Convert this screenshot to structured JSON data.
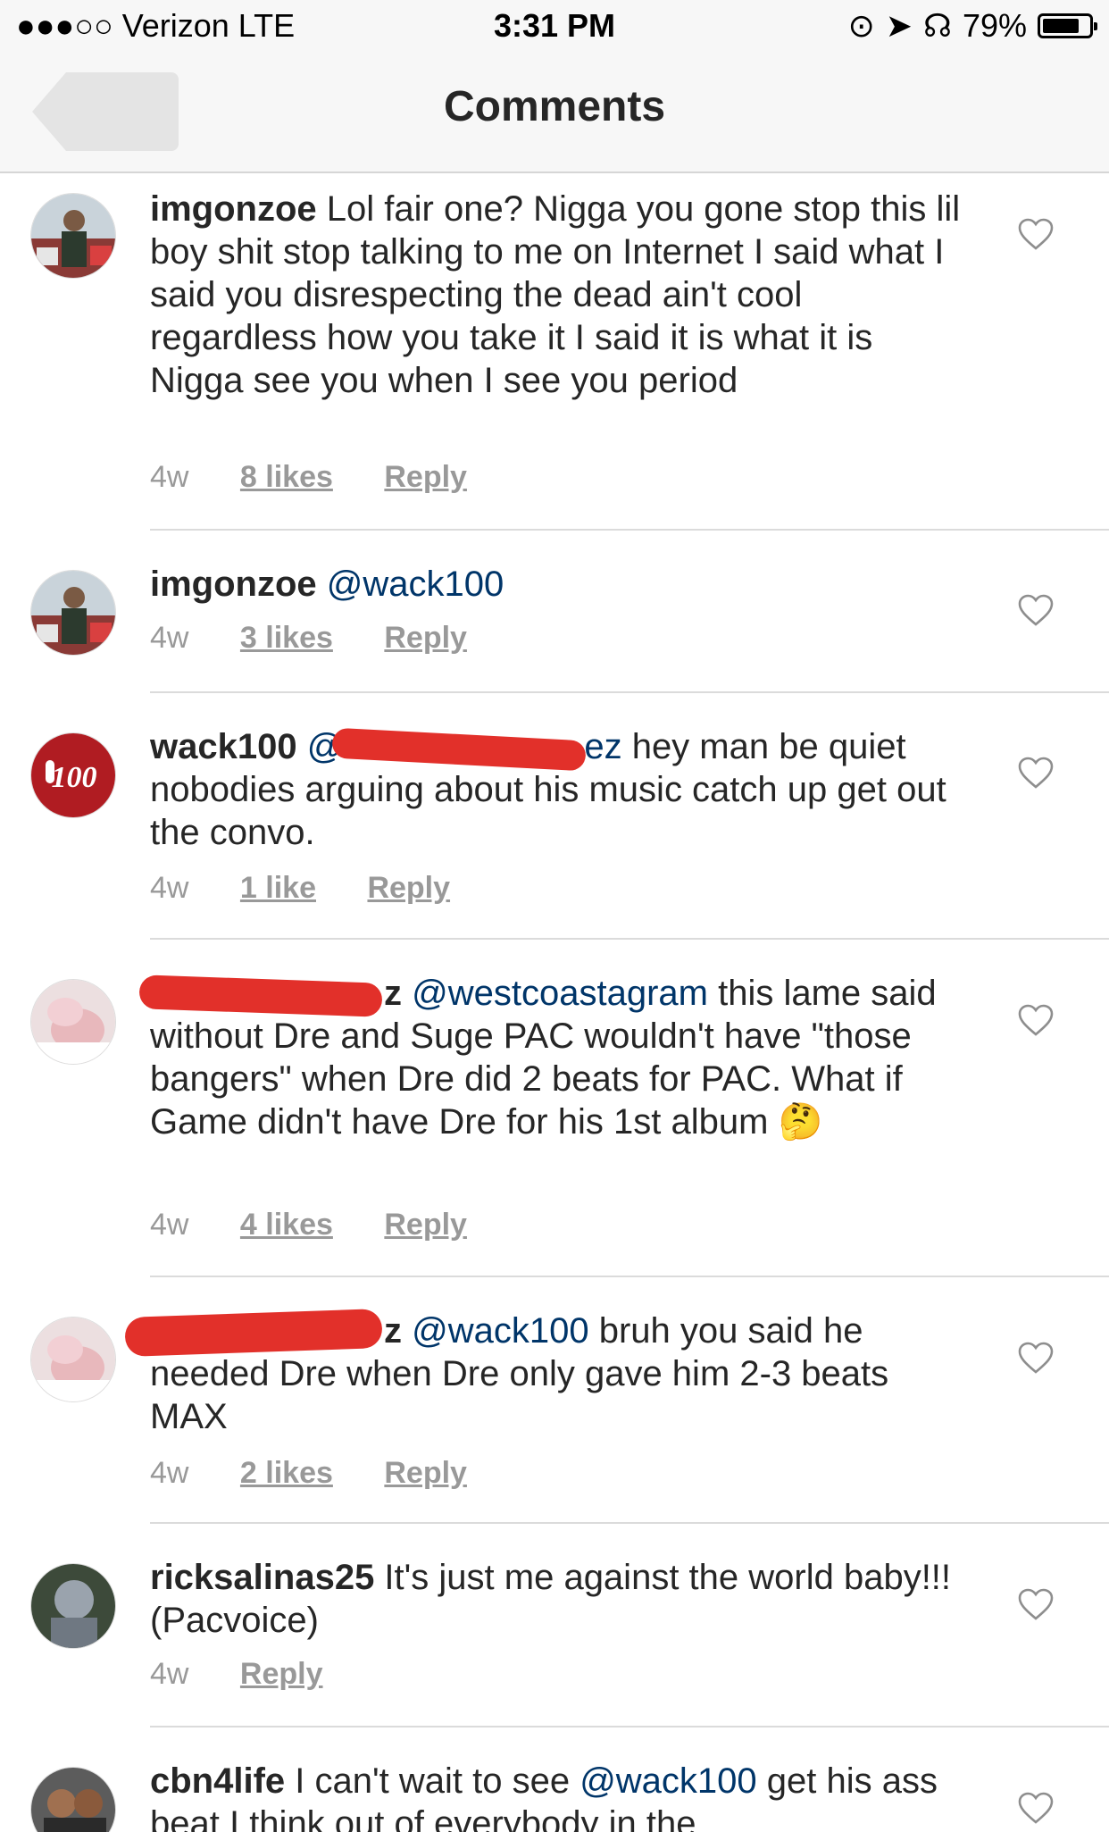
{
  "status_bar": {
    "carrier": "●●●○○ Verizon  LTE",
    "time": "3:31 PM",
    "battery": "79%",
    "battery_level": 0.79
  },
  "nav": {
    "title": "Comments"
  },
  "comments": [
    {
      "user": "imgonzoe",
      "text": "Lol fair one? Nigga you gone stop this lil boy shit stop talking to me on Internet I said what I said you disrespecting the dead ain't cool regardless how you take it I said it is what it is Nigga see you when I see you period",
      "age": "4w",
      "likes": "8 likes",
      "reply": "Reply"
    },
    {
      "user": "imgonzoe",
      "mention": "@wack100",
      "age": "4w",
      "likes": "3 likes",
      "reply": "Reply"
    },
    {
      "user": "wack100",
      "mention_partial": "@",
      "mention_tail": "ez",
      "text": " hey man be quiet nobodies arguing about his music catch up get out the convo.",
      "age": "4w",
      "likes": "1 like",
      "reply": "Reply"
    },
    {
      "user_tail": "z",
      "mention": "@westcoastagram",
      "text": "  this lame said without Dre and Suge PAC wouldn't have \"those bangers\" when Dre did 2 beats for PAC. What if Game didn't have Dre for his 1st album 🤔",
      "age": "4w",
      "likes": "4 likes",
      "reply": "Reply"
    },
    {
      "user_tail": "z",
      "mention": "@wack100",
      "text": "  bruh you said he needed Dre when Dre only gave him 2-3 beats MAX",
      "age": "4w",
      "likes": "2 likes",
      "reply": "Reply"
    },
    {
      "user": "ricksalinas25",
      "text": " It's just me against the world baby!!! (Pacvoice)",
      "age": "4w",
      "reply": "Reply"
    },
    {
      "user": "cbn4life",
      "text_a": " I can't wait to see ",
      "mention": "@wack100",
      "text_b": " get his ass beat I think out of everybody in the"
    }
  ]
}
